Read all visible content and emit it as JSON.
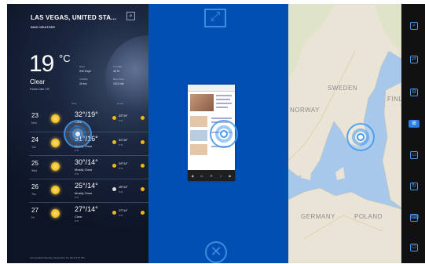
{
  "weather": {
    "location": "LAS VEGAS, UNITED STA...",
    "source": "BING WEATHER",
    "temperature": "19",
    "unit": "°C",
    "condition": "Clear",
    "feels_like": "Feels Like 19°",
    "details": [
      {
        "label": "Wind",
        "value": "SW 8 kph"
      },
      {
        "label": "Visibility",
        "value": "16 km"
      },
      {
        "label": "Humidity",
        "value": "42 %"
      },
      {
        "label": "Barometer",
        "value": "1013 mb"
      }
    ],
    "forecast_header": {
      "daily": "Daily",
      "hourly": "Hourly"
    },
    "forecast": [
      {
        "day": "23",
        "dow": "Mon",
        "hilo": "32°/19°",
        "cond": "Clear",
        "precip": "0 %",
        "m1": "32°/19°",
        "m1p": "0 %"
      },
      {
        "day": "24",
        "dow": "Tue",
        "hilo": "31°/16°",
        "cond": "Mostly Clear",
        "precip": "0 %",
        "m1": "31°/16°",
        "m1p": "0 %"
      },
      {
        "day": "25",
        "dow": "Wed",
        "hilo": "30°/14°",
        "cond": "Mostly Clear",
        "precip": "0 %",
        "m1": "30°/14°",
        "m1p": "0 %"
      },
      {
        "day": "26",
        "dow": "Thu",
        "hilo": "25°/14°",
        "cond": "Mostly Clear",
        "precip": "0 %",
        "m1": "25°/14°",
        "m1p": "0 %"
      },
      {
        "day": "27",
        "dow": "Fri",
        "hilo": "27°/14°",
        "cond": "Clear",
        "precip": "0 %",
        "m1": "27°/14°",
        "m1p": "0 %"
      }
    ],
    "footer": "Last updated Monday, September 23, 2013 5:27 PM"
  },
  "snap": {
    "expand_icon": "expand-arrows-icon",
    "close_icon": "close-circle-icon"
  },
  "map": {
    "labels": {
      "sweden": "SWEDEN",
      "norway": "NORWAY",
      "finland": "FINL",
      "germany": "GERMANY",
      "poland": "POLAND"
    }
  },
  "charms": [
    "search-icon",
    "share-icon",
    "settings-icon",
    "start-icon",
    "devices-icon",
    "refresh-icon",
    "keyboard-icon",
    "power-icon"
  ],
  "colors": {
    "snap_blue": "#0050b4",
    "charm_blue": "#2b7be0",
    "map_water": "#a7c8ea"
  }
}
